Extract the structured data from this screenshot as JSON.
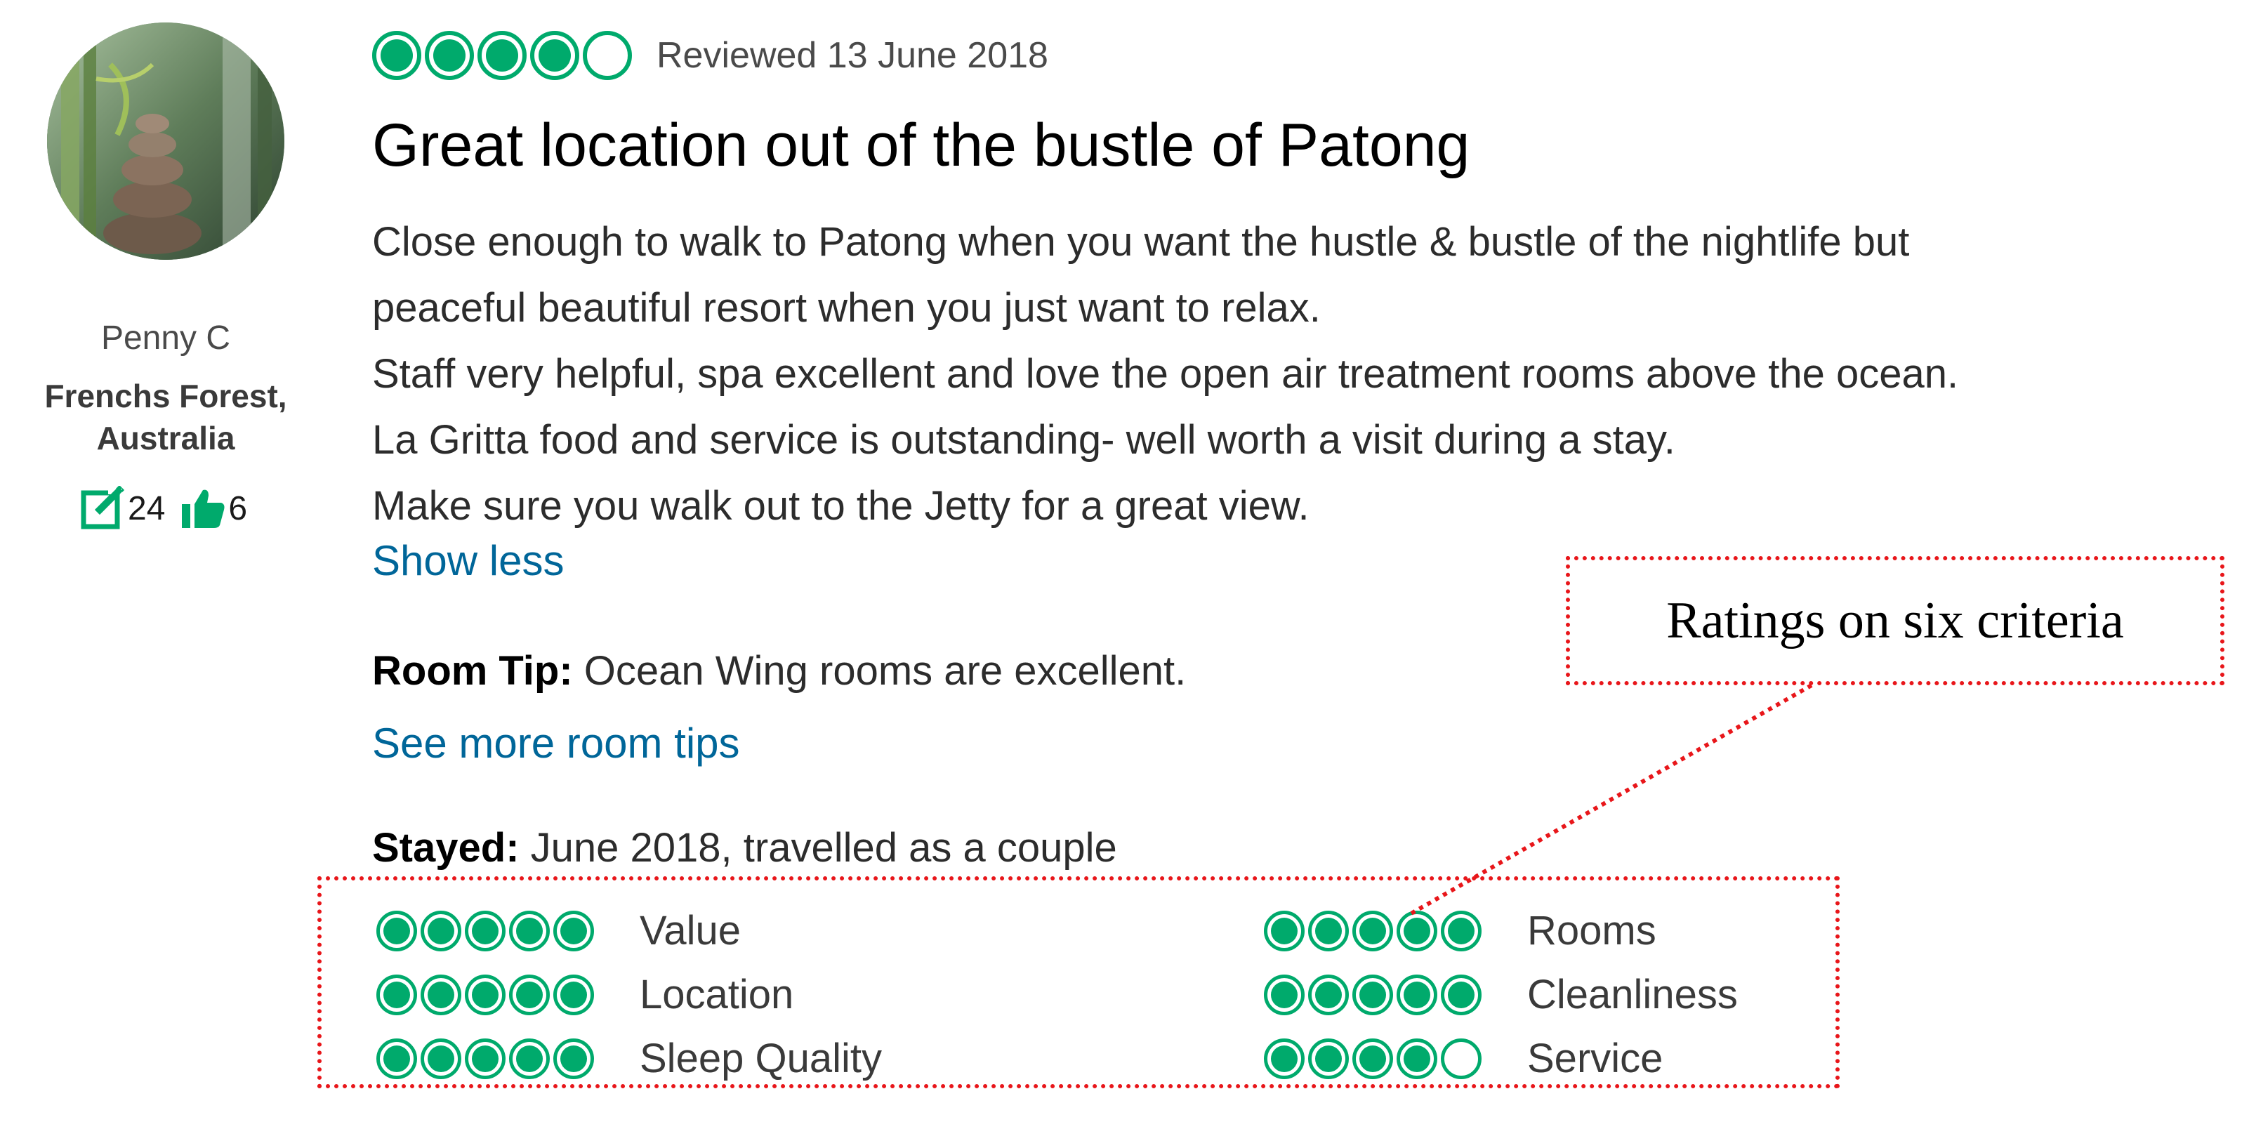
{
  "colors": {
    "bubble_green": "#00aa6c",
    "link_blue": "#006699",
    "annotation_red": "#e8161a"
  },
  "reviewer": {
    "avatar_icon": "avatar-photo-stacked-stones",
    "name": "Penny C",
    "location_line1": "Frenchs Forest,",
    "location_line2": "Australia",
    "reviews_icon": "edit-review-icon",
    "reviews_count": "24",
    "helpful_icon": "thumbs-up-icon",
    "helpful_count": "6"
  },
  "review": {
    "rating": 4,
    "rating_max": 5,
    "date_text": "Reviewed 13 June 2018",
    "title": "Great location out of the bustle of Patong",
    "body_lines": [
      "Close enough to walk to Patong when you want the hustle & bustle of the nightlife but",
      "peaceful beautiful resort when you just want to relax.",
      "Staff very helpful, spa excellent and love the open air treatment rooms above the ocean.",
      "La Gritta food and service is outstanding- well worth a visit during a stay.",
      "Make sure you walk out to the Jetty for a great view."
    ],
    "show_less_label": "Show less",
    "room_tip_label": "Room Tip:",
    "room_tip_text": " Ocean Wing rooms are excellent.",
    "see_more_label": "See more room tips",
    "stayed_label": "Stayed:",
    "stayed_text": " June 2018, travelled as a couple"
  },
  "sub_ratings": [
    {
      "label": "Value",
      "rating": 5
    },
    {
      "label": "Location",
      "rating": 5
    },
    {
      "label": "Sleep Quality",
      "rating": 5
    },
    {
      "label": "Rooms",
      "rating": 5
    },
    {
      "label": "Cleanliness",
      "rating": 5
    },
    {
      "label": "Service",
      "rating": 4
    }
  ],
  "annotation": {
    "callout_text": "Ratings on six criteria"
  }
}
